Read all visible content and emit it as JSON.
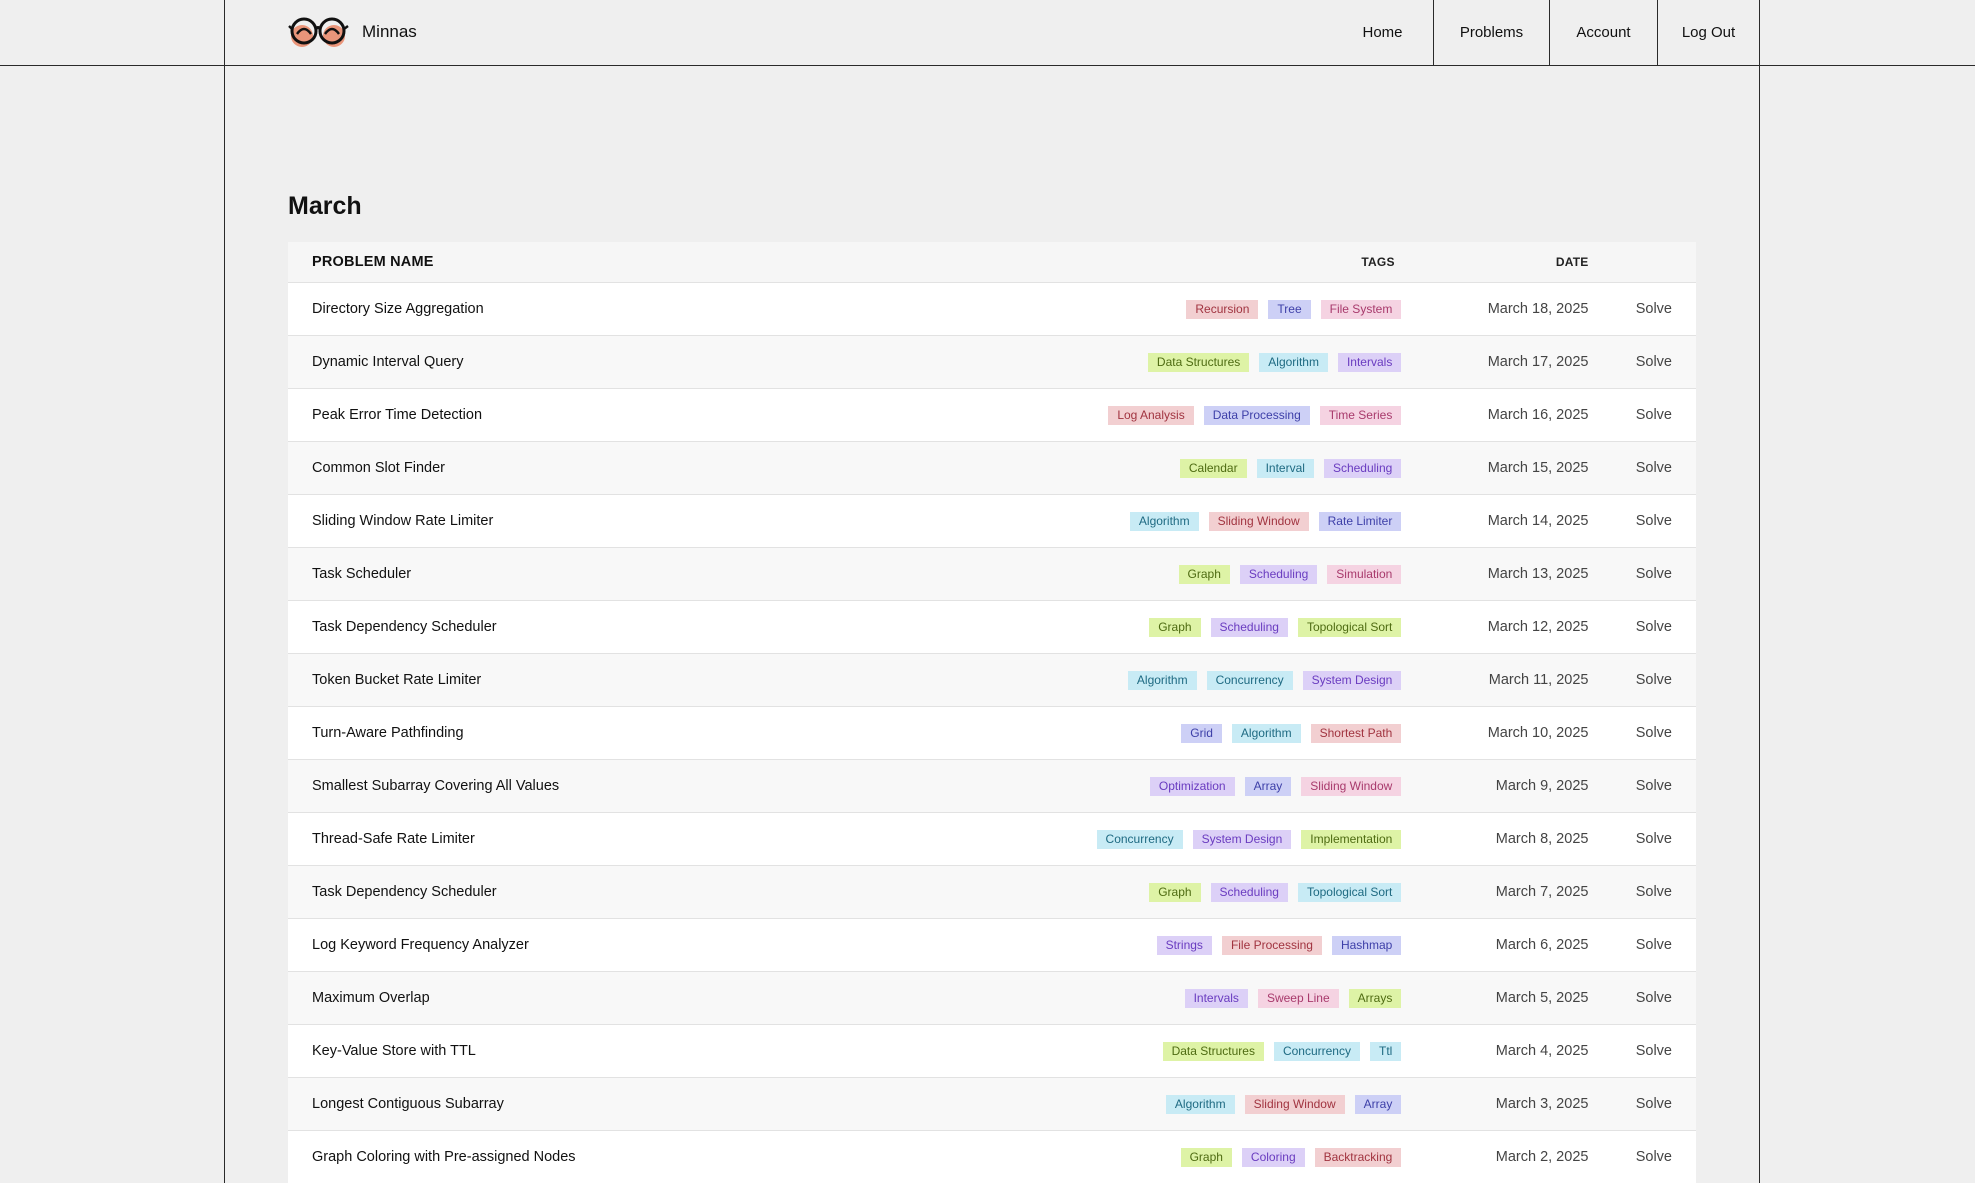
{
  "header": {
    "brand": "Minnas",
    "nav": [
      {
        "label": "Home"
      },
      {
        "label": "Problems"
      },
      {
        "label": "Account"
      },
      {
        "label": "Log Out"
      }
    ]
  },
  "section_title": "March",
  "table": {
    "columns": {
      "name": "PROBLEM NAME",
      "tags": "TAGS",
      "date": "DATE"
    },
    "action_label": "Solve",
    "rows": [
      {
        "name": "Directory Size Aggregation",
        "date": "March 18, 2025",
        "tags": [
          {
            "label": "Recursion",
            "color": "red"
          },
          {
            "label": "Tree",
            "color": "blue"
          },
          {
            "label": "File System",
            "color": "pink"
          }
        ]
      },
      {
        "name": "Dynamic Interval Query",
        "date": "March 17, 2025",
        "tags": [
          {
            "label": "Data Structures",
            "color": "green"
          },
          {
            "label": "Algorithm",
            "color": "cyan"
          },
          {
            "label": "Intervals",
            "color": "purple"
          }
        ]
      },
      {
        "name": "Peak Error Time Detection",
        "date": "March 16, 2025",
        "tags": [
          {
            "label": "Log Analysis",
            "color": "red"
          },
          {
            "label": "Data Processing",
            "color": "blue"
          },
          {
            "label": "Time Series",
            "color": "pink"
          }
        ]
      },
      {
        "name": "Common Slot Finder",
        "date": "March 15, 2025",
        "tags": [
          {
            "label": "Calendar",
            "color": "green"
          },
          {
            "label": "Interval",
            "color": "cyan"
          },
          {
            "label": "Scheduling",
            "color": "purple"
          }
        ]
      },
      {
        "name": "Sliding Window Rate Limiter",
        "date": "March 14, 2025",
        "tags": [
          {
            "label": "Algorithm",
            "color": "cyan"
          },
          {
            "label": "Sliding Window",
            "color": "red"
          },
          {
            "label": "Rate Limiter",
            "color": "blue"
          }
        ]
      },
      {
        "name": "Task Scheduler",
        "date": "March 13, 2025",
        "tags": [
          {
            "label": "Graph",
            "color": "green"
          },
          {
            "label": "Scheduling",
            "color": "purple"
          },
          {
            "label": "Simulation",
            "color": "pink"
          }
        ]
      },
      {
        "name": "Task Dependency Scheduler",
        "date": "March 12, 2025",
        "tags": [
          {
            "label": "Graph",
            "color": "green"
          },
          {
            "label": "Scheduling",
            "color": "purple"
          },
          {
            "label": "Topological Sort",
            "color": "green"
          }
        ]
      },
      {
        "name": "Token Bucket Rate Limiter",
        "date": "March 11, 2025",
        "tags": [
          {
            "label": "Algorithm",
            "color": "cyan"
          },
          {
            "label": "Concurrency",
            "color": "cyan"
          },
          {
            "label": "System Design",
            "color": "purple"
          }
        ]
      },
      {
        "name": "Turn-Aware Pathfinding",
        "date": "March 10, 2025",
        "tags": [
          {
            "label": "Grid",
            "color": "blue"
          },
          {
            "label": "Algorithm",
            "color": "cyan"
          },
          {
            "label": "Shortest Path",
            "color": "red"
          }
        ]
      },
      {
        "name": "Smallest Subarray Covering All Values",
        "date": "March 9, 2025",
        "tags": [
          {
            "label": "Optimization",
            "color": "purple"
          },
          {
            "label": "Array",
            "color": "blue"
          },
          {
            "label": "Sliding Window",
            "color": "pink"
          }
        ]
      },
      {
        "name": "Thread-Safe Rate Limiter",
        "date": "March 8, 2025",
        "tags": [
          {
            "label": "Concurrency",
            "color": "cyan"
          },
          {
            "label": "System Design",
            "color": "purple"
          },
          {
            "label": "Implementation",
            "color": "green"
          }
        ]
      },
      {
        "name": "Task Dependency Scheduler",
        "date": "March 7, 2025",
        "tags": [
          {
            "label": "Graph",
            "color": "green"
          },
          {
            "label": "Scheduling",
            "color": "purple"
          },
          {
            "label": "Topological Sort",
            "color": "cyan"
          }
        ]
      },
      {
        "name": "Log Keyword Frequency Analyzer",
        "date": "March 6, 2025",
        "tags": [
          {
            "label": "Strings",
            "color": "purple"
          },
          {
            "label": "File Processing",
            "color": "red"
          },
          {
            "label": "Hashmap",
            "color": "blue"
          }
        ]
      },
      {
        "name": "Maximum Overlap",
        "date": "March 5, 2025",
        "tags": [
          {
            "label": "Intervals",
            "color": "purple"
          },
          {
            "label": "Sweep Line",
            "color": "pink"
          },
          {
            "label": "Arrays",
            "color": "green"
          }
        ]
      },
      {
        "name": "Key-Value Store with TTL",
        "date": "March 4, 2025",
        "tags": [
          {
            "label": "Data Structures",
            "color": "green"
          },
          {
            "label": "Concurrency",
            "color": "cyan"
          },
          {
            "label": "Ttl",
            "color": "cyan"
          }
        ]
      },
      {
        "name": "Longest Contiguous Subarray",
        "date": "March 3, 2025",
        "tags": [
          {
            "label": "Algorithm",
            "color": "cyan"
          },
          {
            "label": "Sliding Window",
            "color": "red"
          },
          {
            "label": "Array",
            "color": "blue"
          }
        ]
      },
      {
        "name": "Graph Coloring with Pre-assigned Nodes",
        "date": "March 2, 2025",
        "tags": [
          {
            "label": "Graph",
            "color": "green"
          },
          {
            "label": "Coloring",
            "color": "purple"
          },
          {
            "label": "Backtracking",
            "color": "red"
          }
        ]
      }
    ]
  },
  "tag_colors": {
    "red": {
      "bg": "#f2cfd1",
      "fg": "#a13440"
    },
    "pink": {
      "bg": "#f5d3e2",
      "fg": "#a83a6c"
    },
    "blue": {
      "bg": "#cdd0f6",
      "fg": "#3d3fa8"
    },
    "purple": {
      "bg": "#dcd0f7",
      "fg": "#6a3cc0"
    },
    "green": {
      "bg": "#def3a6",
      "fg": "#4e6b12"
    },
    "cyan": {
      "bg": "#c8ebf5",
      "fg": "#1e6a82"
    }
  },
  "icons": {
    "logo": "glasses-logo-icon"
  }
}
